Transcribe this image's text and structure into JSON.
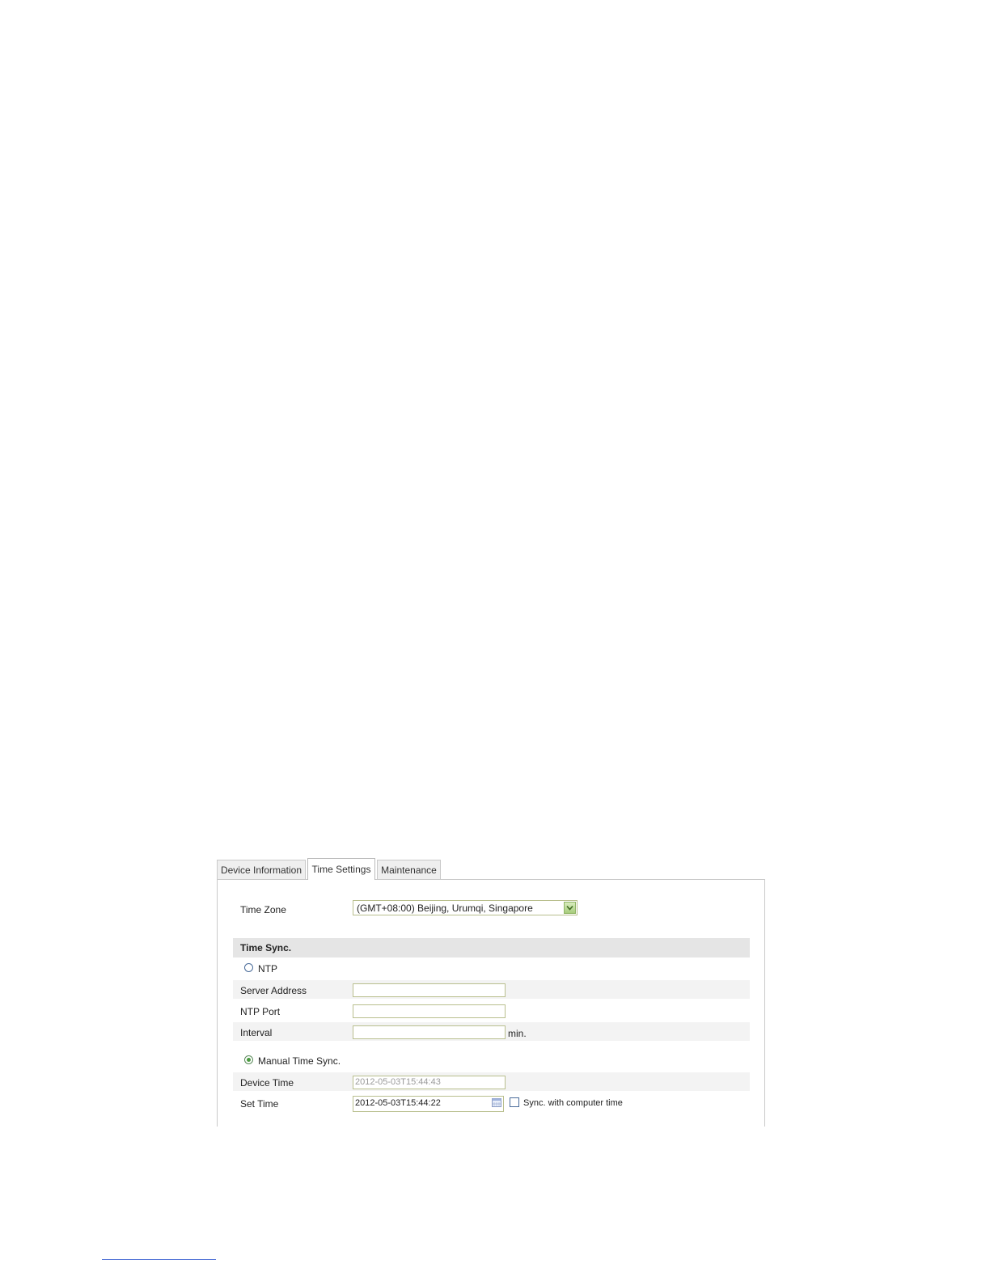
{
  "tabs": [
    {
      "label": "Device Information",
      "active": false
    },
    {
      "label": "Time Settings",
      "active": true
    },
    {
      "label": "Maintenance",
      "active": false
    }
  ],
  "time_zone": {
    "label": "Time Zone",
    "value": "(GMT+08:00) Beijing, Urumqi, Singapore"
  },
  "time_sync": {
    "section_title": "Time Sync.",
    "ntp": {
      "option_label": "NTP",
      "selected": false,
      "server_address_label": "Server Address",
      "server_address_value": "",
      "ntp_port_label": "NTP Port",
      "ntp_port_value": "",
      "interval_label": "Interval",
      "interval_value": "",
      "interval_unit": "min."
    },
    "manual": {
      "option_label": "Manual Time Sync.",
      "selected": true,
      "device_time_label": "Device Time",
      "device_time_value": "2012-05-03T15:44:43",
      "set_time_label": "Set Time",
      "set_time_value": "2012-05-03T15:44:22",
      "sync_computer_label": "Sync. with computer time",
      "sync_computer_checked": false
    }
  },
  "colors": {
    "field_border": "#b9bf8e",
    "section_bg": "#e5e5e5",
    "row_bg": "#f3f3f3",
    "radio_selected": "#4a9a40"
  }
}
